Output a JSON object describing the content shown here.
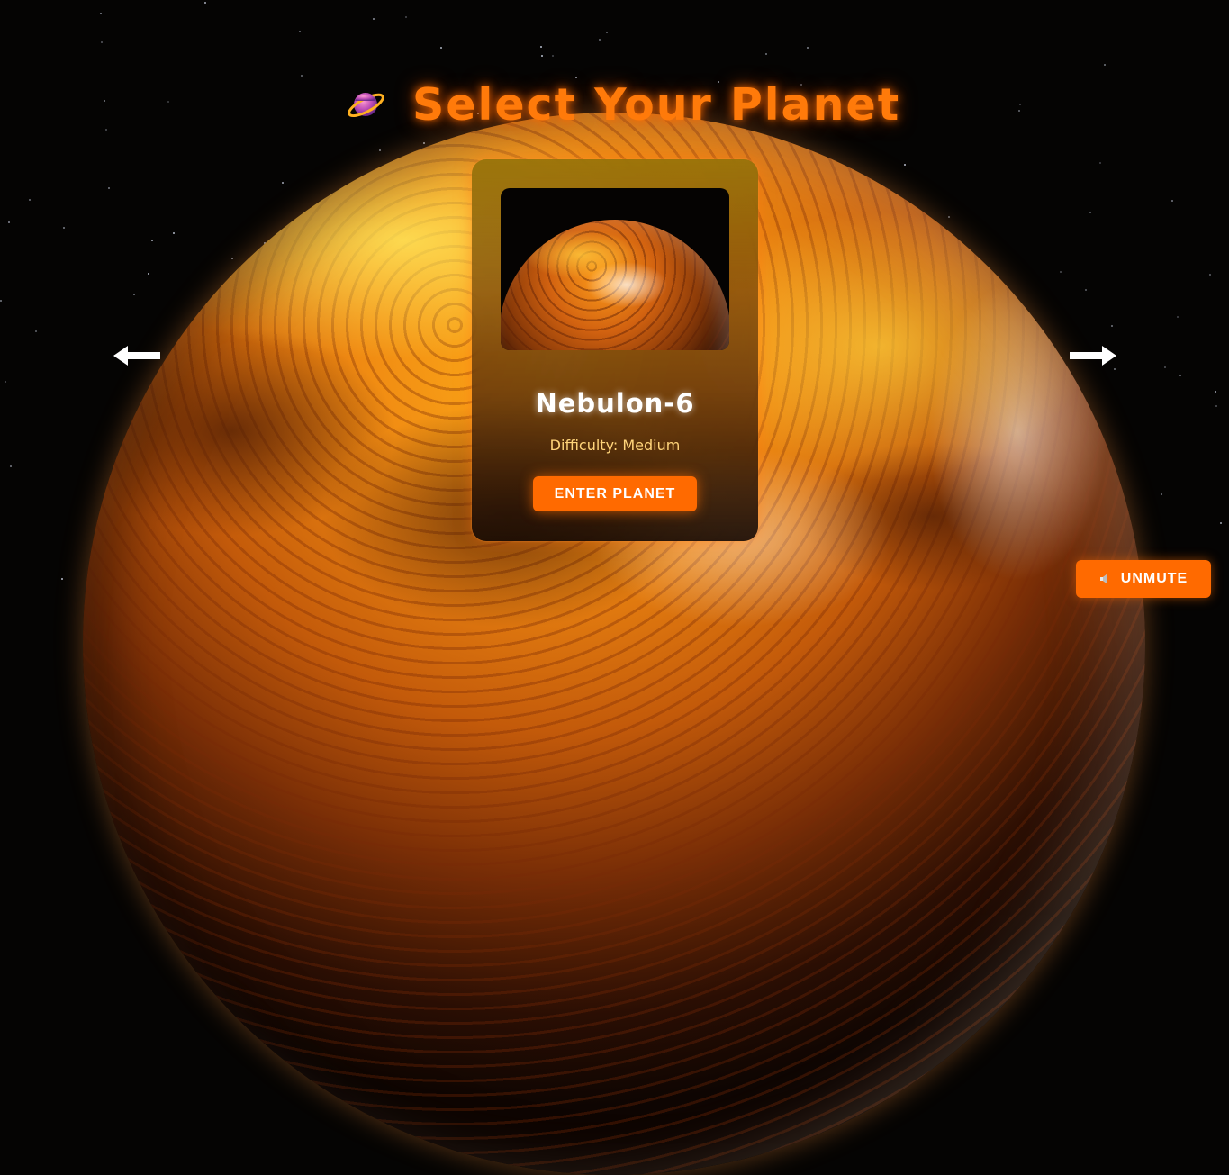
{
  "header": {
    "title": "Select Your Planet",
    "title_icon": "ringed-planet-icon"
  },
  "card": {
    "planet_name": "Nebulon-6",
    "difficulty": "Difficulty: Medium",
    "enter_label": "ENTER PLANET"
  },
  "controls": {
    "prev_icon": "arrow-left-icon",
    "next_icon": "arrow-right-icon",
    "unmute_label": "UNMUTE",
    "unmute_icon": "speaker-icon"
  },
  "colors": {
    "accent": "#ff6a00",
    "title": "#ff7a0a",
    "difficulty_text": "#ffd47a"
  }
}
